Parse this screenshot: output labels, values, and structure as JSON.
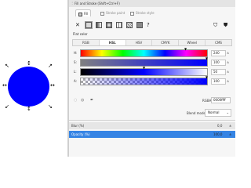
{
  "dialog": {
    "title": "Fill and Stroke (Shift+Ctrl+F)",
    "tabs": [
      "Fill",
      "Stroke paint",
      "Stroke style"
    ],
    "active_tab": "Fill"
  },
  "fill": {
    "section_label": "Flat color",
    "modes": [
      "RGB",
      "HSL",
      "HSV",
      "CMYK",
      "Wheel",
      "CMS"
    ],
    "active_mode": "HSL",
    "sliders": [
      {
        "label": "H:",
        "value": "240"
      },
      {
        "label": "S:",
        "value": "100"
      },
      {
        "label": "L:",
        "value": "50"
      },
      {
        "label": "A:",
        "value": "100"
      }
    ],
    "rgba_label": "RGBA:",
    "rgba_value": "0000ffff"
  },
  "blend": {
    "label": "Blend mode:",
    "value": "Normal"
  },
  "blur": {
    "label": "Blur (%)",
    "value": "0,0"
  },
  "opacity": {
    "label": "Opacity (%)",
    "value": "100,0"
  },
  "colors": {
    "object_fill": "#0000ff",
    "accent": "#3584e4"
  },
  "icons": [
    "circle-shape",
    "selection-arrow-icon",
    "no-paint-icon",
    "flat-color-icon",
    "linear-gradient-icon",
    "radial-gradient-icon",
    "mesh-gradient-icon",
    "pattern-icon",
    "swatch-icon",
    "unset-paint-icon",
    "fill-rule-evenodd-icon",
    "fill-rule-nonzero-icon",
    "eyedropper-icon",
    "dropdown-chevron-icon"
  ]
}
